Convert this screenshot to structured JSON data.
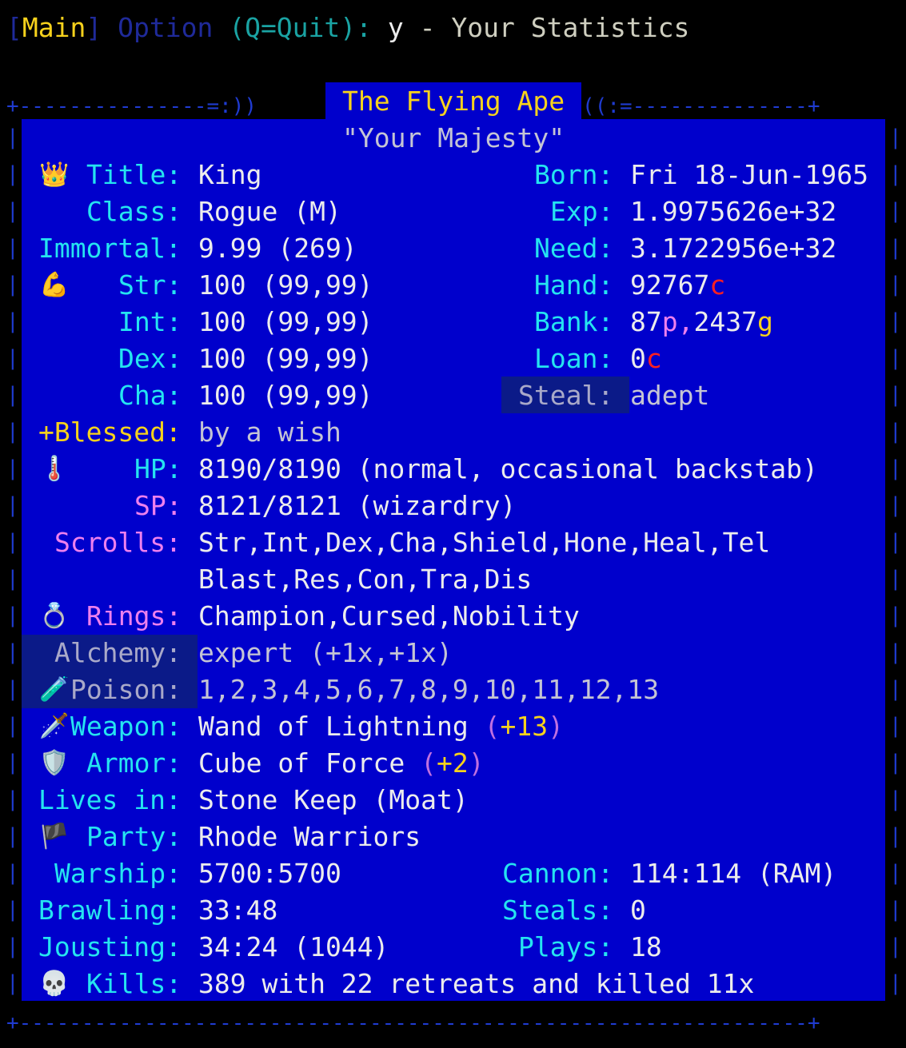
{
  "topbar": {
    "main": "Main",
    "option": "Option",
    "quit": "(Q=Quit):",
    "key": "y",
    "sep": " - ",
    "title": "Your Statistics"
  },
  "header": {
    "name": "The Flying Ape",
    "subtitle": "\"Your Majesty\""
  },
  "left": {
    "title": {
      "label": "Title:",
      "value": "King"
    },
    "class": {
      "label": "Class:",
      "value": "Rogue (M)"
    },
    "immortal": {
      "label": "Immortal:",
      "value": "9.99 (269)"
    },
    "str": {
      "label": "Str:",
      "value": "100 (99,99)"
    },
    "int": {
      "label": "Int:",
      "value": "100 (99,99)"
    },
    "dex": {
      "label": "Dex:",
      "value": "100 (99,99)"
    },
    "cha": {
      "label": "Cha:",
      "value": "100 (99,99)"
    },
    "blessed": {
      "label": "+Blessed:",
      "value": "by a wish"
    },
    "hp": {
      "label": "HP:",
      "value": "8190/8190 (normal, occasional backstab)"
    },
    "sp": {
      "label": "SP:",
      "value": "8121/8121 (wizardry)"
    },
    "scrolls": {
      "label": "Scrolls:",
      "value1": "Str,Int,Dex,Cha,Shield,Hone,Heal,Tel",
      "value2": "Blast,Res,Con,Tra,Dis"
    },
    "rings": {
      "label": "Rings:",
      "value": "Champion,Cursed,Nobility"
    },
    "alchemy": {
      "label": "Alchemy:",
      "value": "expert (+1x,+1x)"
    },
    "poison": {
      "label": "Poison:",
      "value": "1,2,3,4,5,6,7,8,9,10,11,12,13"
    },
    "weapon": {
      "label": "Weapon:",
      "value": "Wand of Lightning",
      "open": "(",
      "bonus": "+13",
      "close": ")"
    },
    "armor": {
      "label": "Armor:",
      "value": "Cube of Force",
      "open": "(",
      "bonus": "+2",
      "close": ")"
    },
    "lives": {
      "label": "Lives in:",
      "value": "Stone Keep (Moat)"
    },
    "party": {
      "label": "Party:",
      "value": "Rhode Warriors"
    },
    "warship": {
      "label": "Warship:",
      "value": "5700:5700"
    },
    "brawling": {
      "label": "Brawling:",
      "value": "33:48"
    },
    "jousting": {
      "label": "Jousting:",
      "value": "34:24 (1044)"
    },
    "kills": {
      "label": "Kills:",
      "value": "389 with 22 retreats and killed 11x"
    }
  },
  "right": {
    "born": {
      "label": "Born:",
      "value": "Fri 18-Jun-1965"
    },
    "exp": {
      "label": "Exp:",
      "value": "1.9975626e+32"
    },
    "need": {
      "label": "Need:",
      "value": "3.1722956e+32"
    },
    "hand": {
      "label": "Hand:",
      "value": "92767",
      "unit": "c"
    },
    "bank": {
      "label": "Bank:",
      "v1": "87",
      "u1": "p",
      "comma": ",",
      "v2": "2437",
      "u2": "g"
    },
    "loan": {
      "label": "Loan:",
      "value": "0",
      "unit": "c"
    },
    "steal": {
      "label": "Steal:",
      "value": "adept"
    },
    "cannon": {
      "label": "Cannon:",
      "value": "114:114 (RAM)"
    },
    "steals": {
      "label": "Steals:",
      "value": "0"
    },
    "plays": {
      "label": "Plays:",
      "value": "18"
    }
  },
  "icons": {
    "crown": "👑",
    "muscle": "💪",
    "thermometer": "🌡️",
    "ring": "💍",
    "potion": "🧪",
    "dagger": "🗡️",
    "shield": "🛡️",
    "flag": "🏴",
    "skull": "💀"
  }
}
